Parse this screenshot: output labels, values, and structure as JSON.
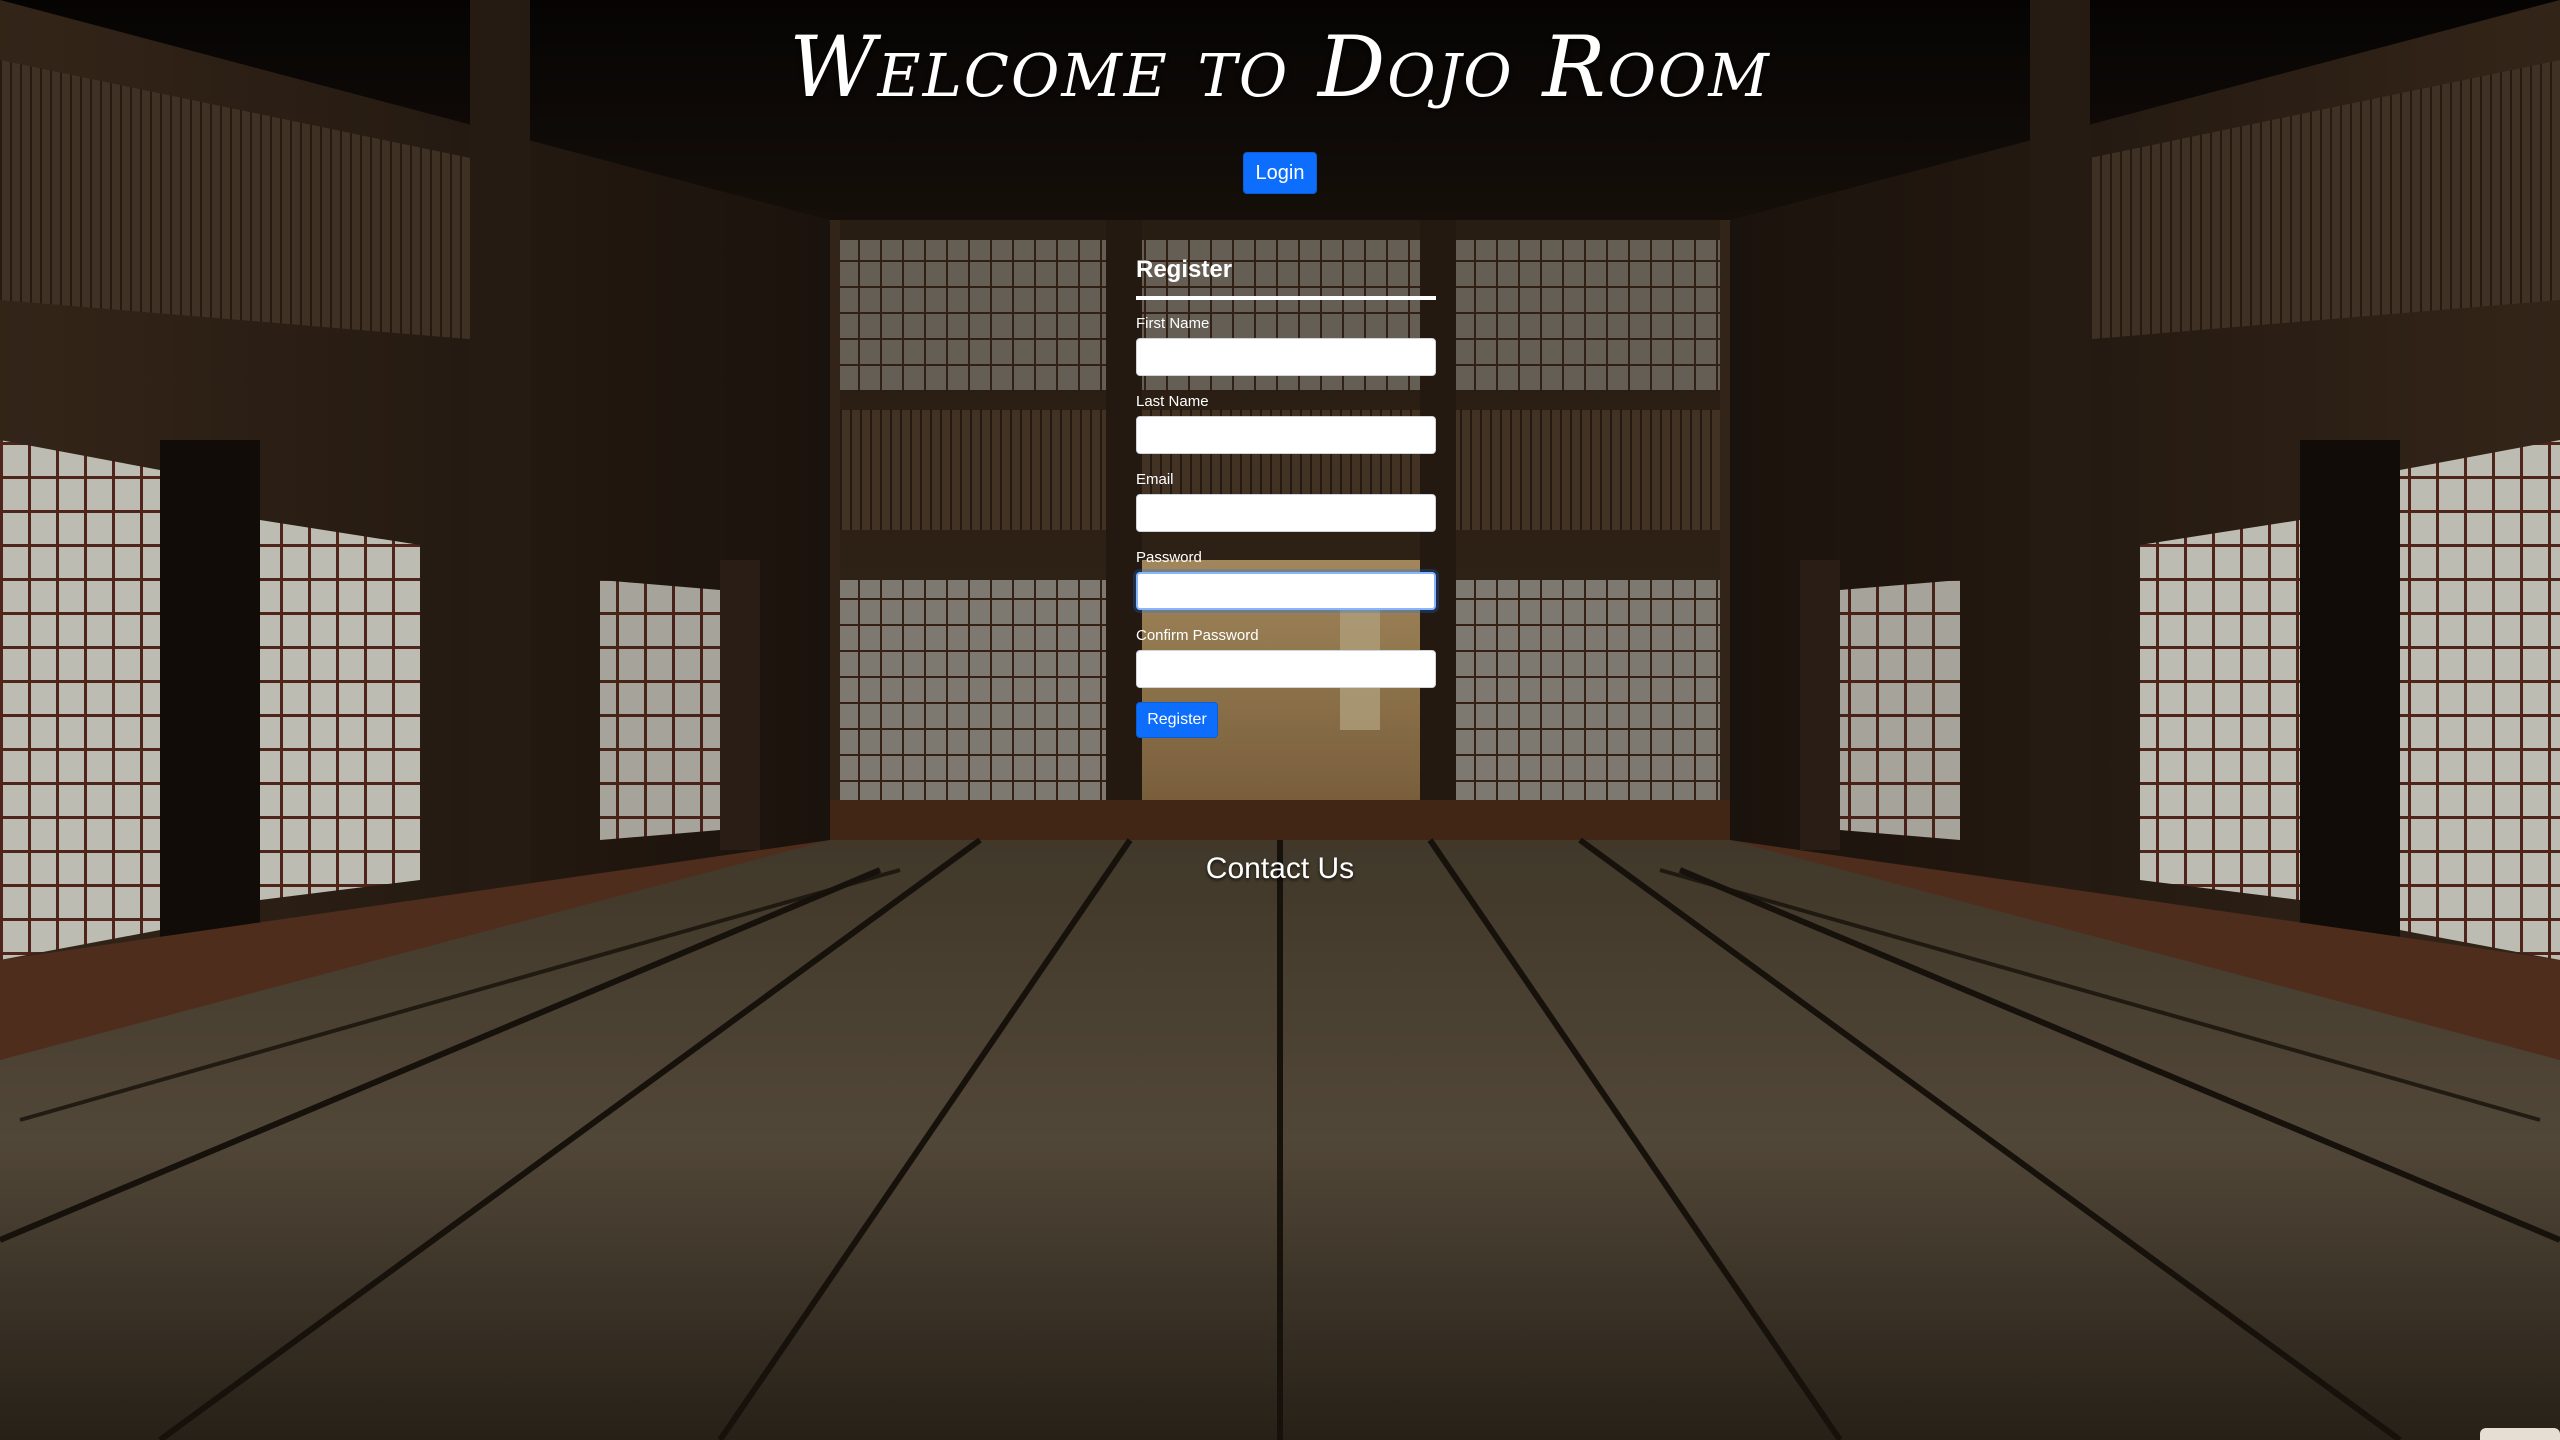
{
  "page": {
    "title": "Welcome to Dojo Room"
  },
  "nav": {
    "login_label": "Login"
  },
  "register_form": {
    "heading": "Register",
    "fields": [
      {
        "label": "First Name",
        "value": ""
      },
      {
        "label": "Last Name",
        "value": ""
      },
      {
        "label": "Email",
        "value": ""
      },
      {
        "label": "Password",
        "value": ""
      },
      {
        "label": "Confirm Password",
        "value": ""
      }
    ],
    "submit_label": "Register"
  },
  "footer": {
    "contact_label": "Contact Us"
  },
  "colors": {
    "button_primary": "#0d6efd",
    "text": "#ffffff",
    "background": "#1a140e"
  }
}
